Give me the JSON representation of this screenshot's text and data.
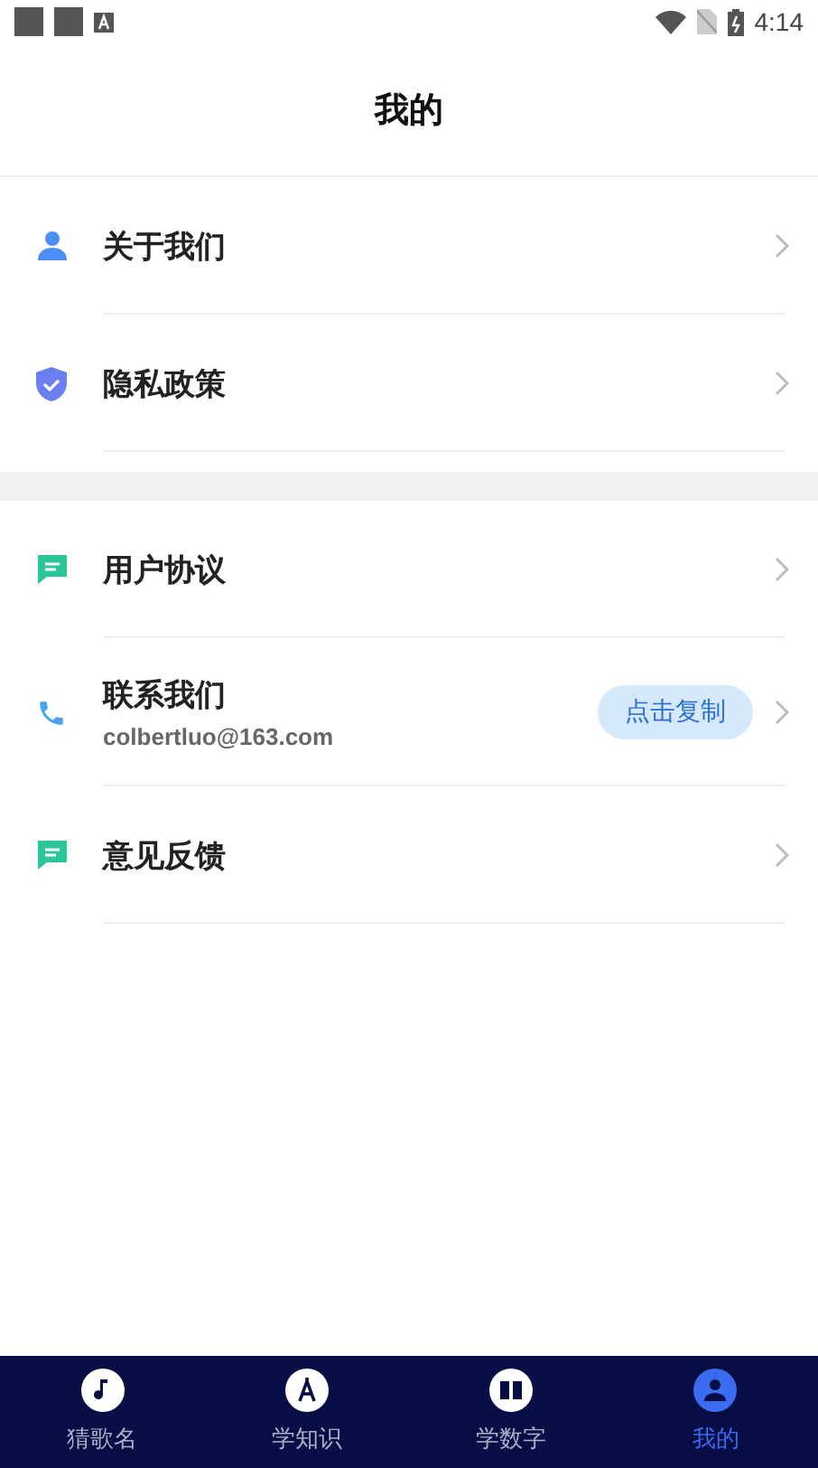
{
  "status_bar": {
    "time": "4:14"
  },
  "header": {
    "title": "我的"
  },
  "sections": [
    {
      "rows": [
        {
          "kind": "plain",
          "label": "关于我们"
        },
        {
          "kind": "plain",
          "label": "隐私政策"
        }
      ]
    },
    {
      "rows": [
        {
          "kind": "plain",
          "label": "用户协议"
        },
        {
          "kind": "contact",
          "label": "联系我们",
          "email": "colbertluo@163.com",
          "action": "点击复制"
        },
        {
          "kind": "plain",
          "label": "意见反馈"
        }
      ]
    }
  ],
  "tab_bar": [
    {
      "label": "猜歌名",
      "selected": false
    },
    {
      "label": "学知识",
      "selected": false
    },
    {
      "label": "学数字",
      "selected": false
    },
    {
      "label": "我的",
      "selected": true
    }
  ]
}
